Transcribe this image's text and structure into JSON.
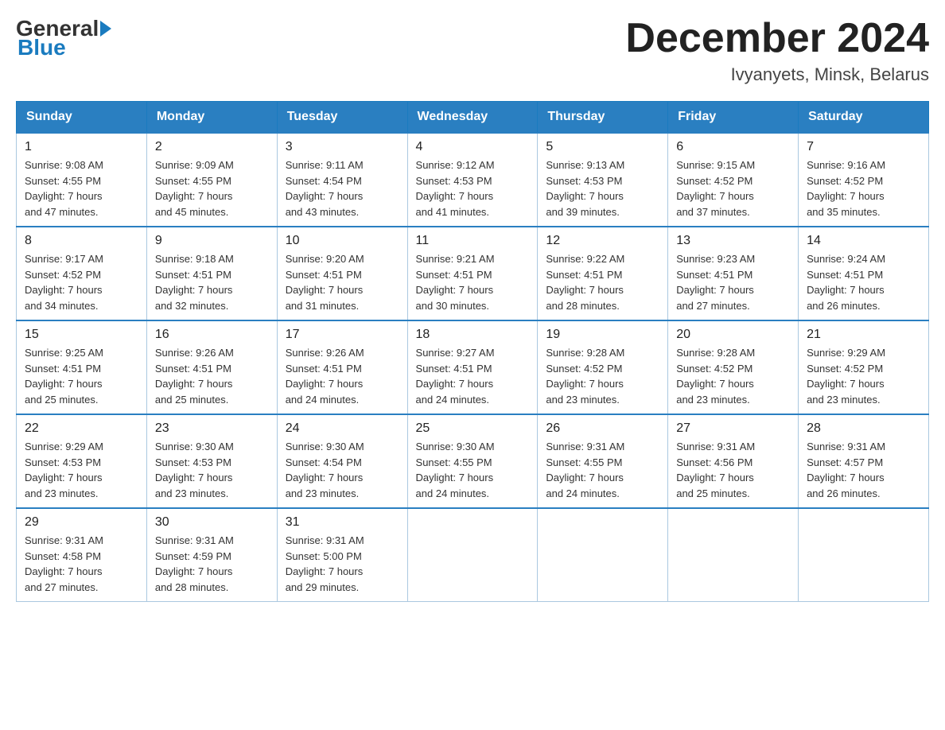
{
  "header": {
    "logo": {
      "general": "General",
      "blue": "Blue"
    },
    "title": "December 2024",
    "location": "Ivyanyets, Minsk, Belarus"
  },
  "days_of_week": [
    "Sunday",
    "Monday",
    "Tuesday",
    "Wednesday",
    "Thursday",
    "Friday",
    "Saturday"
  ],
  "weeks": [
    [
      {
        "day": "1",
        "sunrise": "9:08 AM",
        "sunset": "4:55 PM",
        "daylight": "7 hours and 47 minutes."
      },
      {
        "day": "2",
        "sunrise": "9:09 AM",
        "sunset": "4:55 PM",
        "daylight": "7 hours and 45 minutes."
      },
      {
        "day": "3",
        "sunrise": "9:11 AM",
        "sunset": "4:54 PM",
        "daylight": "7 hours and 43 minutes."
      },
      {
        "day": "4",
        "sunrise": "9:12 AM",
        "sunset": "4:53 PM",
        "daylight": "7 hours and 41 minutes."
      },
      {
        "day": "5",
        "sunrise": "9:13 AM",
        "sunset": "4:53 PM",
        "daylight": "7 hours and 39 minutes."
      },
      {
        "day": "6",
        "sunrise": "9:15 AM",
        "sunset": "4:52 PM",
        "daylight": "7 hours and 37 minutes."
      },
      {
        "day": "7",
        "sunrise": "9:16 AM",
        "sunset": "4:52 PM",
        "daylight": "7 hours and 35 minutes."
      }
    ],
    [
      {
        "day": "8",
        "sunrise": "9:17 AM",
        "sunset": "4:52 PM",
        "daylight": "7 hours and 34 minutes."
      },
      {
        "day": "9",
        "sunrise": "9:18 AM",
        "sunset": "4:51 PM",
        "daylight": "7 hours and 32 minutes."
      },
      {
        "day": "10",
        "sunrise": "9:20 AM",
        "sunset": "4:51 PM",
        "daylight": "7 hours and 31 minutes."
      },
      {
        "day": "11",
        "sunrise": "9:21 AM",
        "sunset": "4:51 PM",
        "daylight": "7 hours and 30 minutes."
      },
      {
        "day": "12",
        "sunrise": "9:22 AM",
        "sunset": "4:51 PM",
        "daylight": "7 hours and 28 minutes."
      },
      {
        "day": "13",
        "sunrise": "9:23 AM",
        "sunset": "4:51 PM",
        "daylight": "7 hours and 27 minutes."
      },
      {
        "day": "14",
        "sunrise": "9:24 AM",
        "sunset": "4:51 PM",
        "daylight": "7 hours and 26 minutes."
      }
    ],
    [
      {
        "day": "15",
        "sunrise": "9:25 AM",
        "sunset": "4:51 PM",
        "daylight": "7 hours and 25 minutes."
      },
      {
        "day": "16",
        "sunrise": "9:26 AM",
        "sunset": "4:51 PM",
        "daylight": "7 hours and 25 minutes."
      },
      {
        "day": "17",
        "sunrise": "9:26 AM",
        "sunset": "4:51 PM",
        "daylight": "7 hours and 24 minutes."
      },
      {
        "day": "18",
        "sunrise": "9:27 AM",
        "sunset": "4:51 PM",
        "daylight": "7 hours and 24 minutes."
      },
      {
        "day": "19",
        "sunrise": "9:28 AM",
        "sunset": "4:52 PM",
        "daylight": "7 hours and 23 minutes."
      },
      {
        "day": "20",
        "sunrise": "9:28 AM",
        "sunset": "4:52 PM",
        "daylight": "7 hours and 23 minutes."
      },
      {
        "day": "21",
        "sunrise": "9:29 AM",
        "sunset": "4:52 PM",
        "daylight": "7 hours and 23 minutes."
      }
    ],
    [
      {
        "day": "22",
        "sunrise": "9:29 AM",
        "sunset": "4:53 PM",
        "daylight": "7 hours and 23 minutes."
      },
      {
        "day": "23",
        "sunrise": "9:30 AM",
        "sunset": "4:53 PM",
        "daylight": "7 hours and 23 minutes."
      },
      {
        "day": "24",
        "sunrise": "9:30 AM",
        "sunset": "4:54 PM",
        "daylight": "7 hours and 23 minutes."
      },
      {
        "day": "25",
        "sunrise": "9:30 AM",
        "sunset": "4:55 PM",
        "daylight": "7 hours and 24 minutes."
      },
      {
        "day": "26",
        "sunrise": "9:31 AM",
        "sunset": "4:55 PM",
        "daylight": "7 hours and 24 minutes."
      },
      {
        "day": "27",
        "sunrise": "9:31 AM",
        "sunset": "4:56 PM",
        "daylight": "7 hours and 25 minutes."
      },
      {
        "day": "28",
        "sunrise": "9:31 AM",
        "sunset": "4:57 PM",
        "daylight": "7 hours and 26 minutes."
      }
    ],
    [
      {
        "day": "29",
        "sunrise": "9:31 AM",
        "sunset": "4:58 PM",
        "daylight": "7 hours and 27 minutes."
      },
      {
        "day": "30",
        "sunrise": "9:31 AM",
        "sunset": "4:59 PM",
        "daylight": "7 hours and 28 minutes."
      },
      {
        "day": "31",
        "sunrise": "9:31 AM",
        "sunset": "5:00 PM",
        "daylight": "7 hours and 29 minutes."
      },
      null,
      null,
      null,
      null
    ]
  ],
  "labels": {
    "sunrise": "Sunrise:",
    "sunset": "Sunset:",
    "daylight": "Daylight:"
  }
}
